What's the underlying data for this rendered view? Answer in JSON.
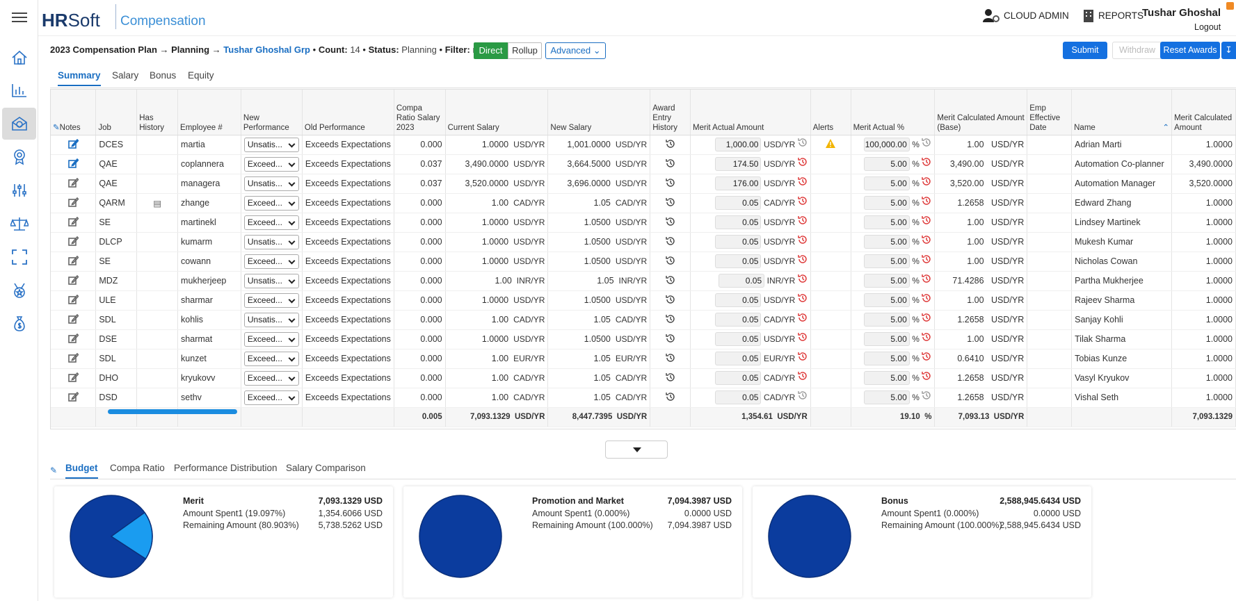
{
  "app": {
    "logo_bold": "HR",
    "logo_rest": "Soft",
    "product": "Compensation"
  },
  "topbar": {
    "cloud_admin": "CLOUD ADMIN",
    "reports": "REPORTS",
    "user_name": "Tushar Ghoshal",
    "logout": "Logout"
  },
  "sidebar": {
    "icons": [
      "menu-icon",
      "home-icon",
      "chart-icon",
      "compensation-icon",
      "award-icon",
      "sliders-icon",
      "balance-icon",
      "expand-icon",
      "medal-icon",
      "money-bag-icon"
    ]
  },
  "breadcrumb": {
    "plan": "2023 Compensation Plan",
    "arrow1": "→",
    "stage": "Planning",
    "arrow2": "→",
    "group": "Tushar Ghoshal Grp",
    "count_label": "Count:",
    "count": "14",
    "status_label": "Status:",
    "status": "Planning",
    "filter_label": "Filter:",
    "filter": "none",
    "dot": "•"
  },
  "view_toggle": {
    "direct": "Direct",
    "rollup": "Rollup",
    "advanced": "Advanced"
  },
  "actions": {
    "submit": "Submit",
    "withdraw": "Withdraw",
    "reset": "Reset Awards"
  },
  "tabs": [
    "Summary",
    "Salary",
    "Bonus",
    "Equity"
  ],
  "columns": {
    "notes": "Notes",
    "job": "Job",
    "has_history": "Has History",
    "employee": "Employee #",
    "new_perf": "New Performance",
    "old_perf": "Old Performance",
    "compa": "Compa Ratio Salary 2023",
    "current": "Current Salary",
    "new_salary": "New Salary",
    "award_hist": "Award Entry History",
    "merit_amt": "Merit Actual Amount",
    "alerts": "Alerts",
    "merit_pct": "Merit Actual %",
    "merit_calc_base": "Merit Calculated Amount (Base)",
    "emp_eff": "Emp Effective Date",
    "name": "Name",
    "merit_calc": "Merit Calculated Amount"
  },
  "rows": [
    {
      "job": "DCES",
      "emp": "martia",
      "newperf": "Unsatis...",
      "oldperf": "Exceeds Expectations",
      "compa": "0.000",
      "cur": "1.0000",
      "cur_u": "USD/YR",
      "new": "1,001.0000",
      "new_u": "USD/YR",
      "amt": "1,000.00",
      "amt_u": "USD/YR",
      "alert": "!",
      "pct": "100,000.00",
      "base": "1.00",
      "base_u": "USD/YR",
      "name": "Adrian Marti",
      "calc": "1.0000"
    },
    {
      "job": "QAE",
      "emp": "coplannera",
      "newperf": "Exceed...",
      "oldperf": "Exceeds Expectations",
      "compa": "0.037",
      "cur": "3,490.0000",
      "cur_u": "USD/YR",
      "new": "3,664.5000",
      "new_u": "USD/YR",
      "amt": "174.50",
      "amt_u": "USD/YR",
      "alert": "",
      "pct": "5.00",
      "base": "3,490.00",
      "base_u": "USD/YR",
      "name": "Automation Co-planner",
      "calc": "3,490.0000"
    },
    {
      "job": "QAE",
      "emp": "managera",
      "newperf": "Unsatis...",
      "oldperf": "Exceeds Expectations",
      "compa": "0.037",
      "cur": "3,520.0000",
      "cur_u": "USD/YR",
      "new": "3,696.0000",
      "new_u": "USD/YR",
      "amt": "176.00",
      "amt_u": "USD/YR",
      "alert": "",
      "pct": "5.00",
      "base": "3,520.00",
      "base_u": "USD/YR",
      "name": "Automation Manager",
      "calc": "3,520.0000"
    },
    {
      "job": "QARM",
      "emp": "zhange",
      "newperf": "Exceed...",
      "oldperf": "Exceeds Expectations",
      "compa": "0.000",
      "cur": "1.00",
      "cur_u": "CAD/YR",
      "new": "1.05",
      "new_u": "CAD/YR",
      "amt": "0.05",
      "amt_u": "CAD/YR",
      "alert": "",
      "pct": "5.00",
      "base": "1.2658",
      "base_u": "USD/YR",
      "name": "Edward Zhang",
      "calc": "1.0000"
    },
    {
      "job": "SE",
      "emp": "martinekl",
      "newperf": "Exceed...",
      "oldperf": "Exceeds Expectations",
      "compa": "0.000",
      "cur": "1.0000",
      "cur_u": "USD/YR",
      "new": "1.0500",
      "new_u": "USD/YR",
      "amt": "0.05",
      "amt_u": "USD/YR",
      "alert": "",
      "pct": "5.00",
      "base": "1.00",
      "base_u": "USD/YR",
      "name": "Lindsey Martinek",
      "calc": "1.0000"
    },
    {
      "job": "DLCP",
      "emp": "kumarm",
      "newperf": "Unsatis...",
      "oldperf": "Exceeds Expectations",
      "compa": "0.000",
      "cur": "1.0000",
      "cur_u": "USD/YR",
      "new": "1.0500",
      "new_u": "USD/YR",
      "amt": "0.05",
      "amt_u": "USD/YR",
      "alert": "",
      "pct": "5.00",
      "base": "1.00",
      "base_u": "USD/YR",
      "name": "Mukesh Kumar",
      "calc": "1.0000"
    },
    {
      "job": "SE",
      "emp": "cowann",
      "newperf": "Exceed...",
      "oldperf": "Exceeds Expectations",
      "compa": "0.000",
      "cur": "1.0000",
      "cur_u": "USD/YR",
      "new": "1.0500",
      "new_u": "USD/YR",
      "amt": "0.05",
      "amt_u": "USD/YR",
      "alert": "",
      "pct": "5.00",
      "base": "1.00",
      "base_u": "USD/YR",
      "name": "Nicholas Cowan",
      "calc": "1.0000"
    },
    {
      "job": "MDZ",
      "emp": "mukherjeep",
      "newperf": "Unsatis...",
      "oldperf": "Exceeds Expectations",
      "compa": "0.000",
      "cur": "1.00",
      "cur_u": "INR/YR",
      "new": "1.05",
      "new_u": "INR/YR",
      "amt": "0.05",
      "amt_u": "INR/YR",
      "alert": "",
      "pct": "5.00",
      "base": "71.4286",
      "base_u": "USD/YR",
      "name": "Partha Mukherjee",
      "calc": "1.0000"
    },
    {
      "job": "ULE",
      "emp": "sharmar",
      "newperf": "Exceed...",
      "oldperf": "Exceeds Expectations",
      "compa": "0.000",
      "cur": "1.0000",
      "cur_u": "USD/YR",
      "new": "1.0500",
      "new_u": "USD/YR",
      "amt": "0.05",
      "amt_u": "USD/YR",
      "alert": "",
      "pct": "5.00",
      "base": "1.00",
      "base_u": "USD/YR",
      "name": "Rajeev Sharma",
      "calc": "1.0000"
    },
    {
      "job": "SDL",
      "emp": "kohlis",
      "newperf": "Unsatis...",
      "oldperf": "Exceeds Expectations",
      "compa": "0.000",
      "cur": "1.00",
      "cur_u": "CAD/YR",
      "new": "1.05",
      "new_u": "CAD/YR",
      "amt": "0.05",
      "amt_u": "CAD/YR",
      "alert": "",
      "pct": "5.00",
      "base": "1.2658",
      "base_u": "USD/YR",
      "name": "Sanjay Kohli",
      "calc": "1.0000"
    },
    {
      "job": "DSE",
      "emp": "sharmat",
      "newperf": "Exceed...",
      "oldperf": "Exceeds Expectations",
      "compa": "0.000",
      "cur": "1.0000",
      "cur_u": "USD/YR",
      "new": "1.0500",
      "new_u": "USD/YR",
      "amt": "0.05",
      "amt_u": "USD/YR",
      "alert": "",
      "pct": "5.00",
      "base": "1.00",
      "base_u": "USD/YR",
      "name": "Tilak Sharma",
      "calc": "1.0000"
    },
    {
      "job": "SDL",
      "emp": "kunzet",
      "newperf": "Exceed...",
      "oldperf": "Exceeds Expectations",
      "compa": "0.000",
      "cur": "1.00",
      "cur_u": "EUR/YR",
      "new": "1.05",
      "new_u": "EUR/YR",
      "amt": "0.05",
      "amt_u": "EUR/YR",
      "alert": "",
      "pct": "5.00",
      "base": "0.6410",
      "base_u": "USD/YR",
      "name": "Tobias Kunze",
      "calc": "1.0000"
    },
    {
      "job": "DHO",
      "emp": "kryukovv",
      "newperf": "Exceed...",
      "oldperf": "Exceeds Expectations",
      "compa": "0.000",
      "cur": "1.00",
      "cur_u": "CAD/YR",
      "new": "1.05",
      "new_u": "CAD/YR",
      "amt": "0.05",
      "amt_u": "CAD/YR",
      "alert": "",
      "pct": "5.00",
      "base": "1.2658",
      "base_u": "USD/YR",
      "name": "Vasyl Kryukov",
      "calc": "1.0000"
    },
    {
      "job": "DSD",
      "emp": "sethv",
      "newperf": "Exceed...",
      "oldperf": "Exceeds Expectations",
      "compa": "0.000",
      "cur": "1.00",
      "cur_u": "CAD/YR",
      "new": "1.05",
      "new_u": "CAD/YR",
      "amt": "0.05",
      "amt_u": "CAD/YR",
      "alert": "",
      "pct": "5.00",
      "base": "1.2658",
      "base_u": "USD/YR",
      "name": "Vishal Seth",
      "calc": "1.0000"
    }
  ],
  "totals": {
    "compa": "0.005",
    "cur": "7,093.1329",
    "cur_u": "USD/YR",
    "new": "8,447.7395",
    "new_u": "USD/YR",
    "amt": "1,354.61",
    "amt_u": "USD/YR",
    "pct": "19.10",
    "pct_u": "%",
    "base": "7,093.13",
    "base_u": "USD/YR",
    "calc": "7,093.1329"
  },
  "pct_sign": "%",
  "bottom_tabs": [
    "Budget",
    "Compa Ratio",
    "Performance Distribution",
    "Salary Comparison"
  ],
  "budget": [
    {
      "title": "Merit",
      "total": "7,093.1329 USD",
      "l1": "Amount Spent1 (19.097%)",
      "v1": "1,354.6066 USD",
      "l2": "Remaining Amount (80.903%)",
      "v2": "5,738.5262 USD",
      "spent_fraction": 0.19097
    },
    {
      "title": "Promotion and Market",
      "total": "7,094.3987 USD",
      "l1": "Amount Spent1 (0.000%)",
      "v1": "0.0000 USD",
      "l2": "Remaining Amount (100.000%)",
      "v2": "7,094.3987 USD",
      "spent_fraction": 0
    },
    {
      "title": "Bonus",
      "total": "2,588,945.6434 USD",
      "l1": "Amount Spent1 (0.000%)",
      "v1": "0.0000 USD",
      "l2": "Remaining Amount (100.000%)",
      "v2": "2,588,945.6434 USD",
      "spent_fraction": 0
    }
  ],
  "colors": {
    "accent": "#1a6ec2",
    "direct": "#2a9a44",
    "pie_dark": "#0b3c9e",
    "pie_light": "#1a9cf0"
  }
}
